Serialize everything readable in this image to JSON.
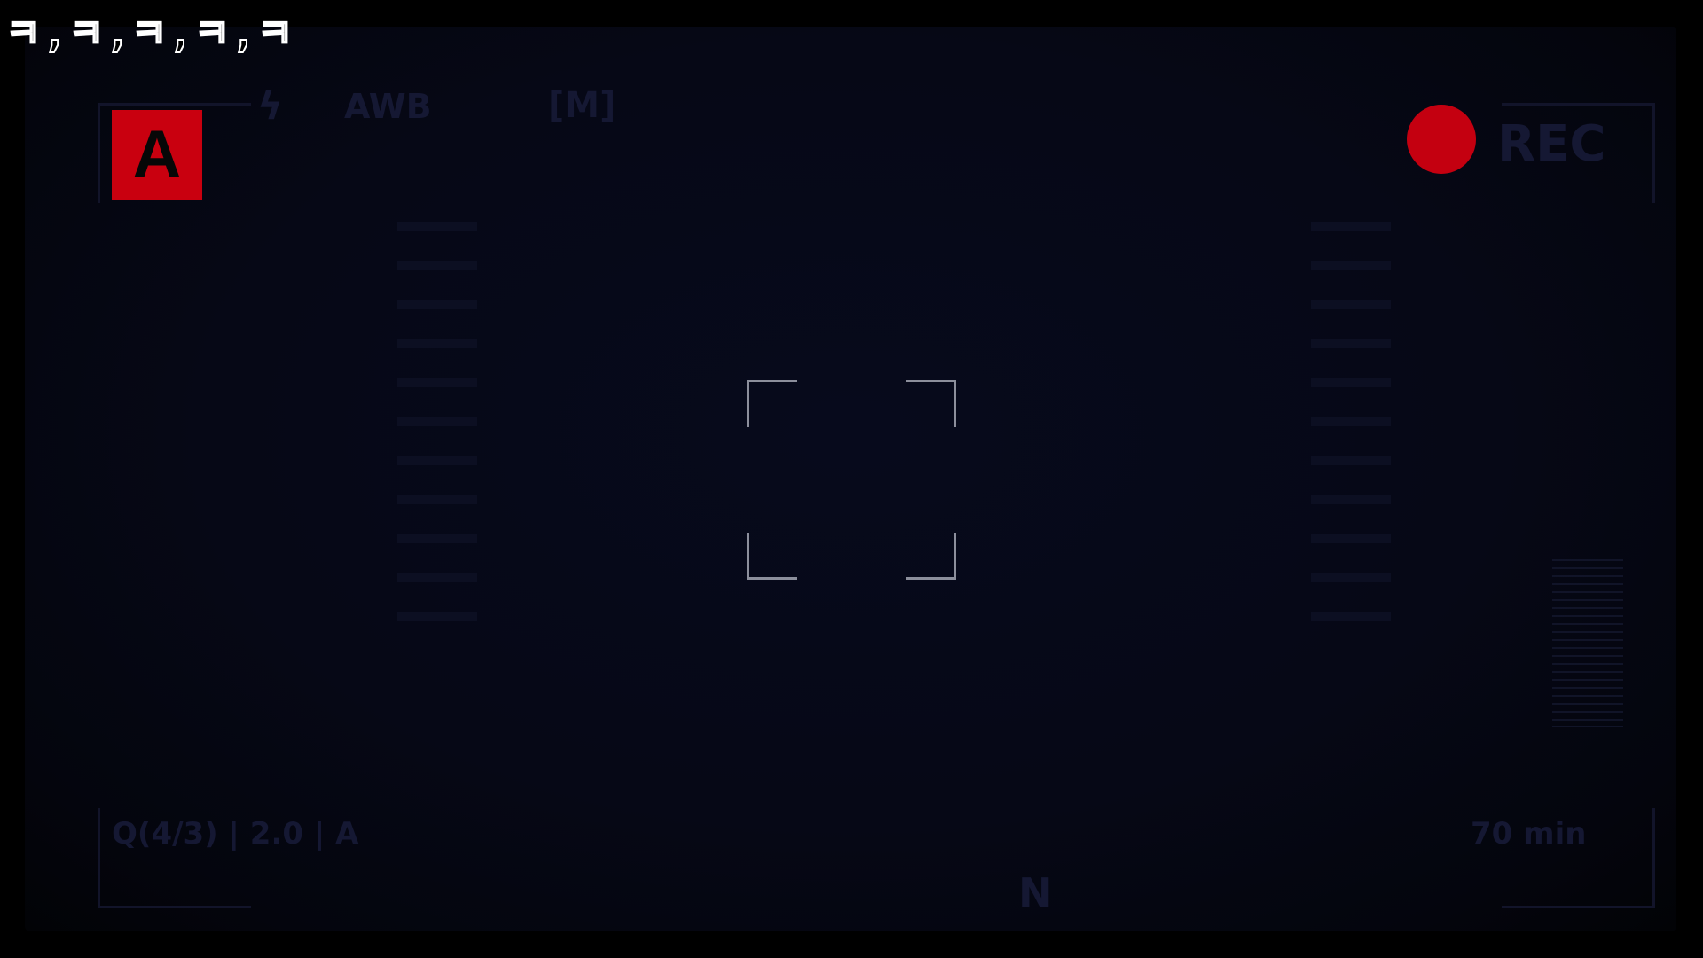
{
  "stamp_text": "ㅋ,ㅋ,ㅋ,ㅋ,ㅋ",
  "mode_label": "A",
  "rec_label": "REC",
  "top_info": {
    "flash": "ϟ",
    "awb": "AWB",
    "metering": "[M]"
  },
  "bottom_info": {
    "left": "Q(4/3) | 2.0 | A",
    "center": "N",
    "right": "70 min"
  },
  "colors": {
    "mode_badge": "#c9000f",
    "rec_dot": "#c40010",
    "focus_bracket": "#8c8f9c",
    "stamp_stroke": "#ffffff"
  }
}
